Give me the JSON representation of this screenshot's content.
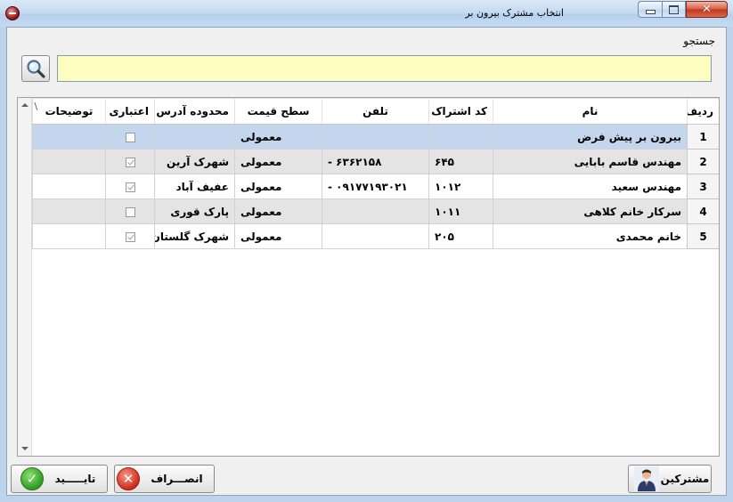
{
  "window": {
    "title": "انتخاب مشترک بیرون بر",
    "minimize": "minimize",
    "maximize": "maximize",
    "close_glyph": "✕"
  },
  "search": {
    "label": "جستجو",
    "value": "",
    "placeholder": ""
  },
  "grid": {
    "columns": [
      "ردیف",
      "نام",
      "کد اشتراک",
      "تلفن",
      "سطح قیمت",
      "محدوده آدرس",
      "اعتباری",
      "توضیحات"
    ],
    "corner_mark": "\\",
    "rows": [
      {
        "idx": "1",
        "name": "بیرون بر پیش فرض",
        "code": "",
        "phone": "",
        "price_level": "معمولی",
        "address": "",
        "credit": false,
        "notes": "",
        "selected": true
      },
      {
        "idx": "2",
        "name": "مهندس قاسم بابایی",
        "code": "۶۴۵",
        "phone": "۶۳۶۲۱۵۸ -",
        "price_level": "معمولی",
        "address": "شهرک آرین",
        "credit": true,
        "notes": ""
      },
      {
        "idx": "3",
        "name": "مهندس سعید",
        "code": "۱۰۱۲",
        "phone": "۰۹۱۷۷۱۹۳۰۲۱ -",
        "price_level": "معمولی",
        "address": "عفیف آباد",
        "credit": true,
        "notes": ""
      },
      {
        "idx": "4",
        "name": "سرکار خانم کلاهی",
        "code": "۱۰۱۱",
        "phone": "",
        "price_level": "معمولی",
        "address": "پارک قوری",
        "credit": false,
        "notes": ""
      },
      {
        "idx": "5",
        "name": "خانم محمدی",
        "code": "۲۰۵",
        "phone": "",
        "price_level": "معمولی",
        "address": "شهرک گلستان",
        "credit": true,
        "notes": ""
      }
    ]
  },
  "buttons": {
    "confirm": "تایـــــید",
    "cancel": "انصـــراف",
    "customers": "مشترکین"
  },
  "icons": {
    "search": "magnifier-icon",
    "confirm": "check-icon",
    "cancel": "x-icon",
    "customers": "person-icon"
  },
  "colors": {
    "search_bg": "#fdfdc0",
    "selected_row": "#c3d6ee",
    "alt_row": "#e4e4e4",
    "ok_green": "#2f9a1e",
    "cancel_red": "#d02a1a"
  }
}
